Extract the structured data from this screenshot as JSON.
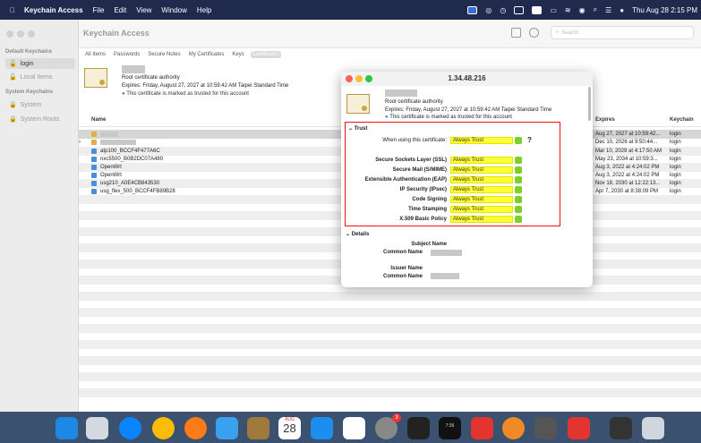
{
  "menubar": {
    "app": "Keychain Access",
    "items": [
      "File",
      "Edit",
      "View",
      "Window",
      "Help"
    ],
    "clock": "Thu Aug 28  2:15 PM"
  },
  "window": {
    "title": "Keychain Access",
    "search_placeholder": "Search"
  },
  "sidebar": {
    "default_header": "Default Keychains",
    "default_items": [
      "login",
      "Local Items"
    ],
    "system_header": "System Keychains",
    "system_items": [
      "System",
      "System Roots"
    ]
  },
  "tabs": [
    "All Items",
    "Passwords",
    "Secure Notes",
    "My Certificates",
    "Keys",
    "Certificates"
  ],
  "selected": {
    "type": "Root certificate authority",
    "expires": "Expires: Friday, August 27, 2027 at 10:59:42 AM Taipei Standard Time",
    "trusted": "This certificate is marked as trusted for this account"
  },
  "list": {
    "headers": {
      "name": "Name",
      "expires": "Expires",
      "keychain": "Keychain"
    },
    "rows": [
      {
        "name": "",
        "expires": "Aug 27, 2027 at 10:59:42...",
        "keychain": "login"
      },
      {
        "name": "",
        "expires": "Dec 10, 2026 at 9:50:44...",
        "keychain": "login"
      },
      {
        "name": "atp100_BCCF4F477A6C",
        "expires": "Mar 10, 2029 at 4:17:50 AM",
        "keychain": "login"
      },
      {
        "name": "nxc5500_B0B2DC07A480",
        "expires": "May 23, 2034 at 10:59:3...",
        "keychain": "login"
      },
      {
        "name": "OpenWrt",
        "expires": "Aug 3, 2022 at 4:24:02 PM",
        "keychain": "login"
      },
      {
        "name": "OpenWrt",
        "expires": "Aug 3, 2022 at 4:24:02 PM",
        "keychain": "login"
      },
      {
        "name": "usg210_A0E4CB843530",
        "expires": "Nov 18, 2030 at 12:22:13...",
        "keychain": "login"
      },
      {
        "name": "usg_flex_500_BCCF4FB89B28",
        "expires": "Apr 7, 2030 at 8:38:09 PM",
        "keychain": "login"
      }
    ]
  },
  "dialog": {
    "title": "1.34.48.216",
    "type": "Root certificate authority",
    "expires": "Expires: Friday, August 27, 2027 at 10:59:42 AM Taipei Standard Time",
    "trusted": "This certificate is marked as trusted for this account",
    "trust_label": "Trust",
    "when_using": "When using this certificate:",
    "when_value": "Always Trust",
    "help": "?",
    "policies": [
      {
        "label": "Secure Sockets Layer (SSL)",
        "value": "Always Trust"
      },
      {
        "label": "Secure Mail (S/MIME)",
        "value": "Always Trust"
      },
      {
        "label": "Extensible Authentication (EAP)",
        "value": "Always Trust"
      },
      {
        "label": "IP Security (IPsec)",
        "value": "Always Trust"
      },
      {
        "label": "Code Signing",
        "value": "Always Trust"
      },
      {
        "label": "Time Stamping",
        "value": "Always Trust"
      },
      {
        "label": "X.509 Basic Policy",
        "value": "Always Trust"
      }
    ],
    "details_label": "Details",
    "subject_name": "Subject Name",
    "common_name": "Common Name",
    "issuer_name": "Issuer Name",
    "common_name2": "Common Name"
  },
  "dock": {
    "calendar_month": "AUG",
    "calendar_day": "28",
    "badge": "3",
    "clock_app": "7:36"
  }
}
